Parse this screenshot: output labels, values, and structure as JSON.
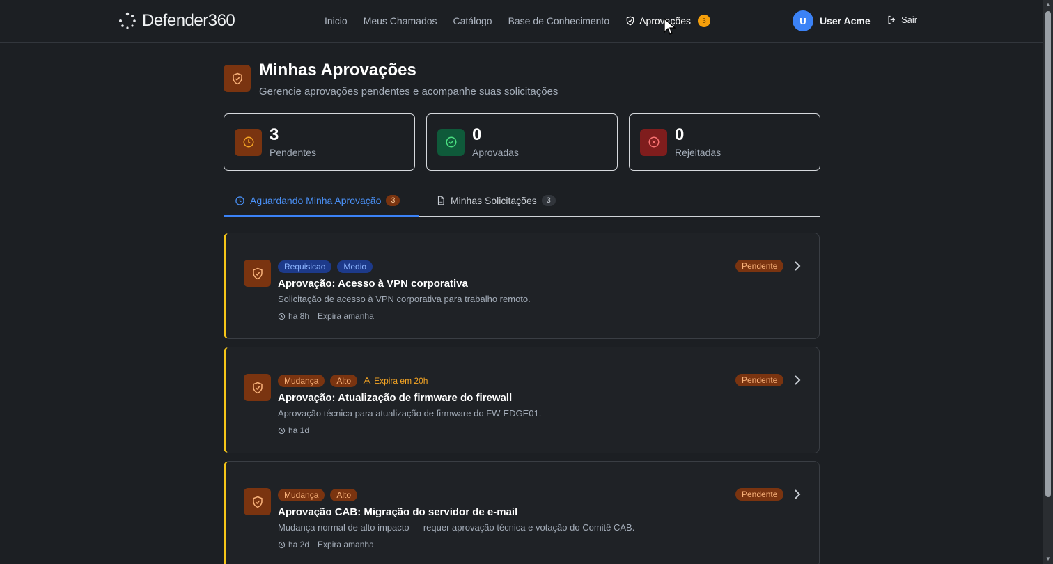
{
  "nav": {
    "brand": "Defender360",
    "links": [
      "Inicio",
      "Meus Chamados",
      "Catálogo",
      "Base de Conhecimento"
    ],
    "active_link": "Aprovações",
    "active_badge": "3",
    "user_initial": "U",
    "user_name": "User Acme",
    "logout": "Sair"
  },
  "header": {
    "title": "Minhas Aprovações",
    "subtitle": "Gerencie aprovações pendentes e acompanhe suas solicitações"
  },
  "stats": [
    {
      "value": "3",
      "label": "Pendentes",
      "icon": "clock-icon",
      "color": "#7a3410"
    },
    {
      "value": "0",
      "label": "Aprovadas",
      "icon": "check-circle-icon",
      "color": "#0f5a3a"
    },
    {
      "value": "0",
      "label": "Rejeitadas",
      "icon": "x-circle-icon",
      "color": "#7f1d1d"
    }
  ],
  "tabs": [
    {
      "label": "Aguardando Minha Aprovação",
      "count": "3",
      "icon": "clock-icon"
    },
    {
      "label": "Minhas Solicitações",
      "count": "3",
      "icon": "document-icon"
    }
  ],
  "approvals": [
    {
      "tags": [
        "Requisicao",
        "Medio"
      ],
      "warning": "",
      "title": "Aprovação: Acesso à VPN corporativa",
      "description": "Solicitação de acesso à VPN corporativa para trabalho remoto.",
      "time": "ha 8h",
      "expires": "Expira amanha",
      "status": "Pendente"
    },
    {
      "tags": [
        "Mudança",
        "Alto"
      ],
      "warning": "Expira em 20h",
      "title": "Aprovação: Atualização de firmware do firewall",
      "description": "Aprovação técnica para atualização de firmware do FW-EDGE01.",
      "time": "ha 1d",
      "expires": "",
      "status": "Pendente"
    },
    {
      "tags": [
        "Mudança",
        "Alto"
      ],
      "warning": "",
      "title": "Aprovação CAB: Migração do servidor de e-mail",
      "description": "Mudança normal de alto impacto — requer aprovação técnica e votação do Comitê CAB.",
      "time": "ha 2d",
      "expires": "Expira amanha",
      "status": "Pendente"
    }
  ]
}
